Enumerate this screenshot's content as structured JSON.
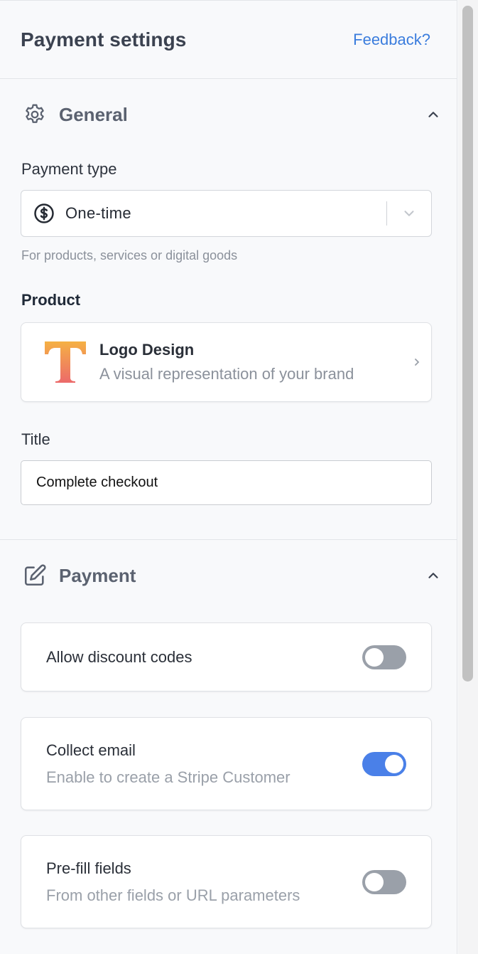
{
  "header": {
    "title": "Payment settings",
    "feedback": "Feedback?"
  },
  "general": {
    "title": "General",
    "icon": "gear-icon",
    "payment_type_label": "Payment type",
    "payment_type_value": "One-time",
    "payment_type_hint": "For products, services or digital goods",
    "product_label": "Product",
    "product": {
      "name": "Logo Design",
      "description": "A visual representation of your brand"
    },
    "title_label": "Title",
    "title_value": "Complete checkout"
  },
  "payment": {
    "title": "Payment",
    "icon": "edit-icon",
    "toggles": [
      {
        "title": "Allow discount codes",
        "subtitle": "",
        "on": false
      },
      {
        "title": "Collect email",
        "subtitle": "Enable to create a Stripe Customer",
        "on": true
      },
      {
        "title": "Pre-fill fields",
        "subtitle": "From other fields or URL parameters",
        "on": false
      }
    ]
  },
  "colors": {
    "accent": "#3b7ddd",
    "toggle_on": "#4a80e8",
    "toggle_off": "#9aa0a9"
  }
}
